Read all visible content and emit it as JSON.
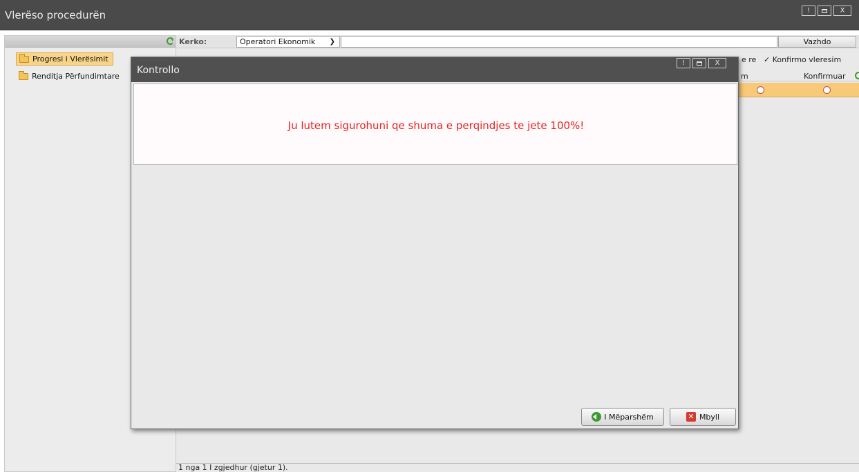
{
  "window": {
    "title": "Vlerëso procedurën",
    "controls": [
      "!",
      "□",
      "X"
    ]
  },
  "sidebar": {
    "items": [
      {
        "label": "Progresi i Vlerësimit",
        "selected": true
      },
      {
        "label": "Renditja Përfundimtare",
        "selected": false
      }
    ]
  },
  "search": {
    "label": "Kerko:",
    "selected_option": "Operatori Ekonomik",
    "value": "",
    "submit_label": "Vazhdo"
  },
  "toolbar": {
    "partial_label": "e re",
    "confirm_label": "✓ Konfirmo vleresim"
  },
  "table": {
    "columns": [
      "m",
      "Konfirmuar"
    ]
  },
  "status_bar": {
    "text": "1 nga 1 I zgjedhur (gjetur 1)."
  },
  "modal": {
    "title": "Kontrollo",
    "message": "Ju lutem sigurohuni qe shuma e perqindjes te jete 100%!",
    "back_label": "I Mëparshëm",
    "close_label": "Mbyll"
  },
  "colors": {
    "accent": "#f7c978",
    "error_text": "#e8221d",
    "title_bar": "#4a4a4a"
  }
}
